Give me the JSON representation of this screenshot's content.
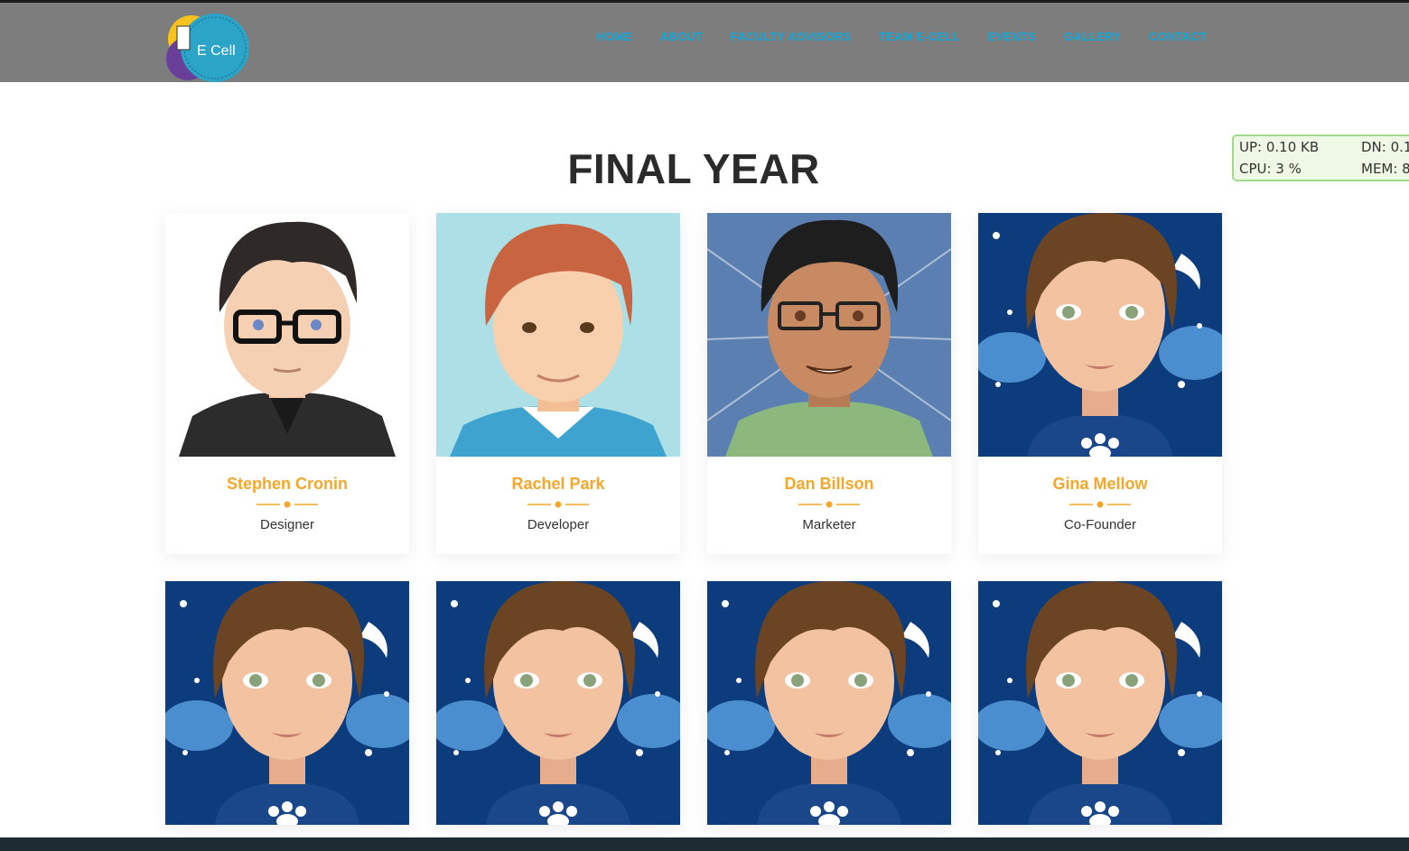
{
  "brand": {
    "logo_text": "E Cell"
  },
  "nav": {
    "items": [
      "HOME",
      "ABOUT",
      "FACULTY ADVISORS",
      "TEAM E-CELL",
      "EVENTS",
      "GALLERY",
      "CONTACT"
    ]
  },
  "netmon": {
    "up": "UP: 0.10 KB",
    "dn": "DN: 0.1",
    "cpu": "CPU: 3 %",
    "mem": "MEM: 8"
  },
  "section": {
    "title": "FINAL YEAR"
  },
  "members": [
    {
      "name": "Stephen Cronin",
      "role": "Designer",
      "avatar": "man-glasses-dark-hair"
    },
    {
      "name": "Rachel Park",
      "role": "Developer",
      "avatar": "man-red-hair"
    },
    {
      "name": "Dan Billson",
      "role": "Marketer",
      "avatar": "man-glasses-tan"
    },
    {
      "name": "Gina Mellow",
      "role": "Co-Founder",
      "avatar": "woman-night-sky"
    }
  ],
  "second_row": [
    {
      "avatar": "woman-night-sky"
    },
    {
      "avatar": "woman-night-sky"
    },
    {
      "avatar": "woman-night-sky"
    },
    {
      "avatar": "woman-night-sky"
    }
  ],
  "colors": {
    "accent": "#f4a72a",
    "nav_link": "#16a6d6",
    "navbar": "#7d7d7d"
  }
}
